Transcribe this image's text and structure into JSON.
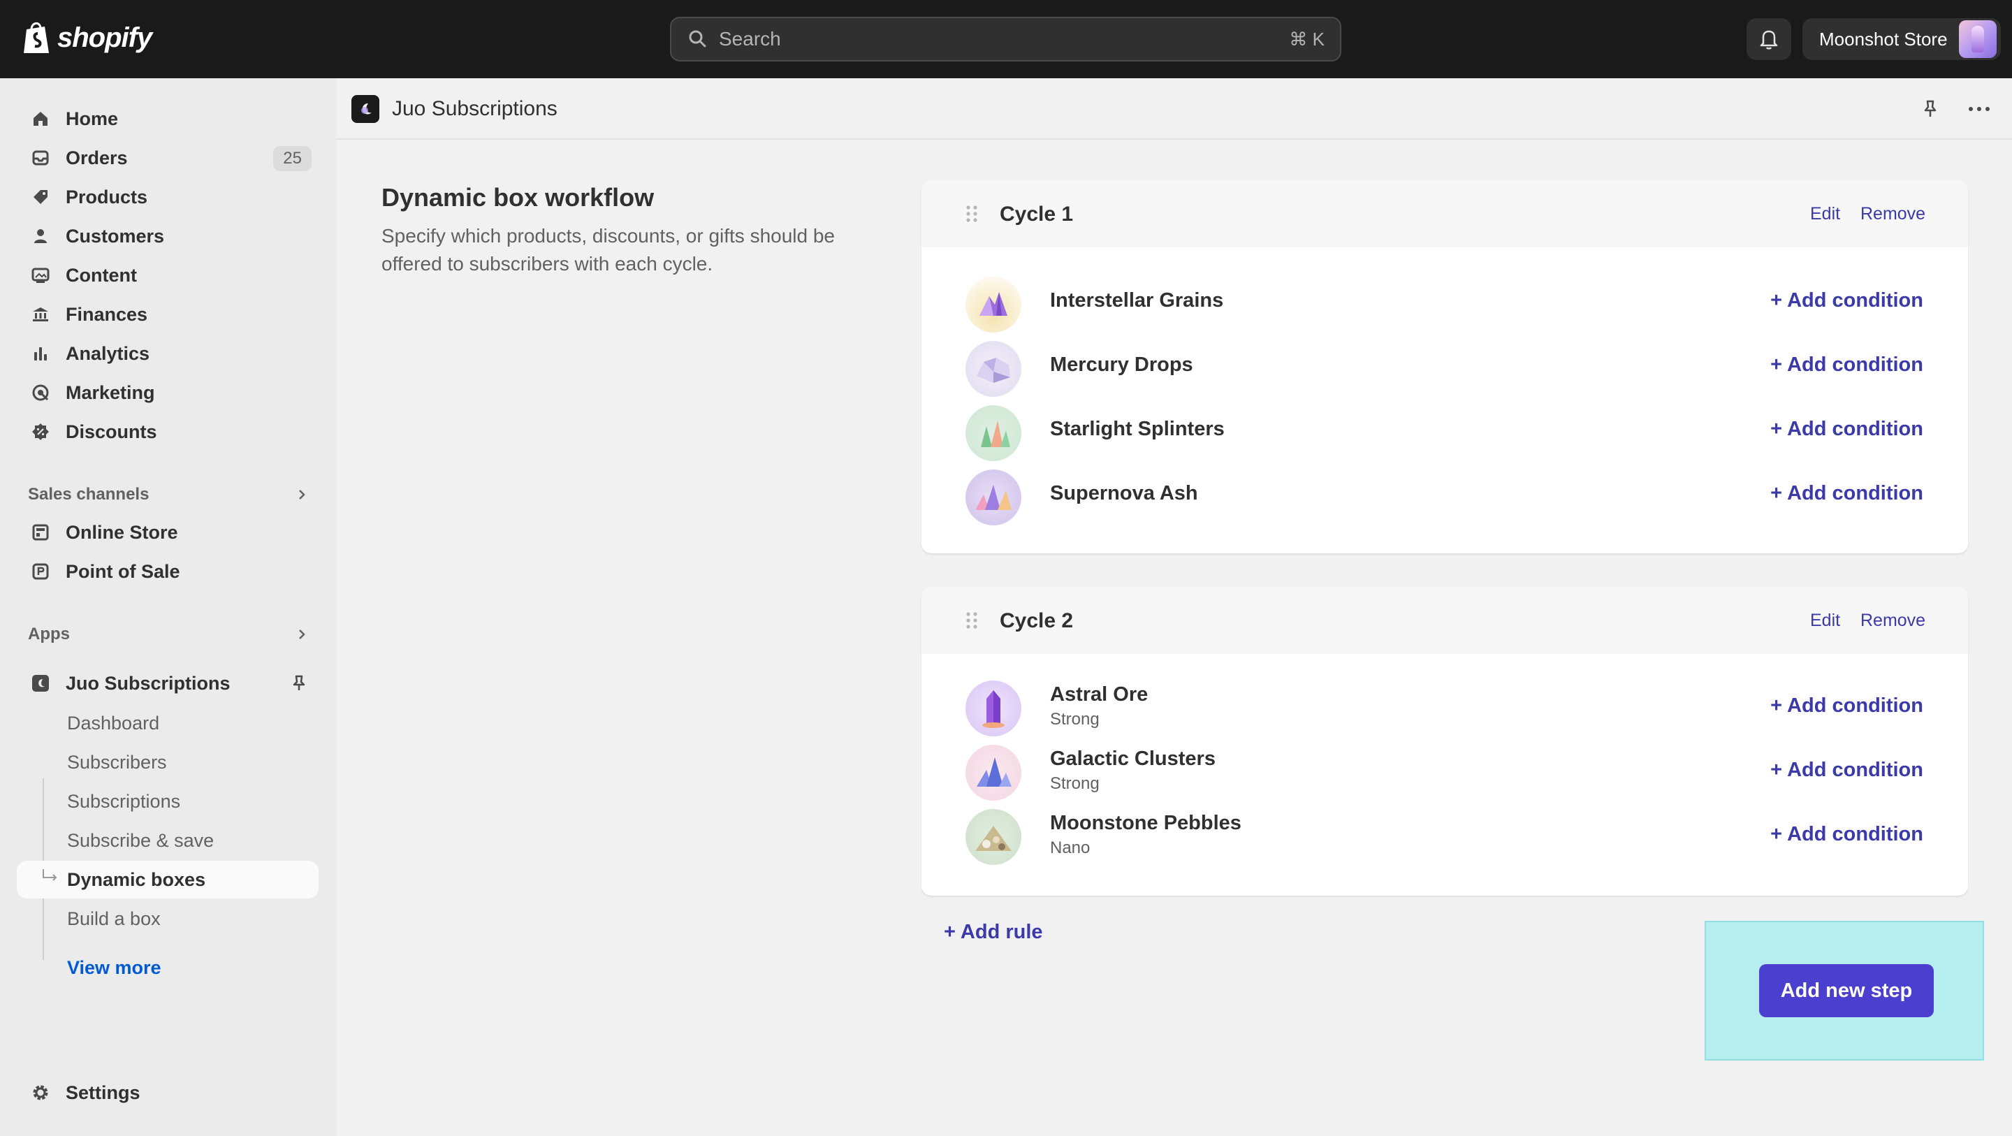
{
  "topbar": {
    "brand": "shopify",
    "search_placeholder": "Search",
    "search_shortcut": "⌘ K",
    "store_name": "Moonshot Store"
  },
  "sidebar": {
    "items": [
      {
        "label": "Home",
        "icon": "home-icon"
      },
      {
        "label": "Orders",
        "icon": "inbox-icon",
        "badge": "25"
      },
      {
        "label": "Products",
        "icon": "tag-icon"
      },
      {
        "label": "Customers",
        "icon": "person-icon"
      },
      {
        "label": "Content",
        "icon": "image-icon"
      },
      {
        "label": "Finances",
        "icon": "bank-icon"
      },
      {
        "label": "Analytics",
        "icon": "bar-chart-icon"
      },
      {
        "label": "Marketing",
        "icon": "target-icon"
      },
      {
        "label": "Discounts",
        "icon": "discount-icon"
      }
    ],
    "sales_channels_title": "Sales channels",
    "sales_channels": [
      {
        "label": "Online Store",
        "icon": "store-icon"
      },
      {
        "label": "Point of Sale",
        "icon": "pos-icon"
      }
    ],
    "apps_title": "Apps",
    "app": {
      "label": "Juo Subscriptions",
      "icon": "moon-icon"
    },
    "app_sub_items": [
      "Dashboard",
      "Subscribers",
      "Subscriptions",
      "Subscribe & save",
      "Dynamic boxes",
      "Build a box"
    ],
    "active_sub_item": "Dynamic boxes",
    "view_more": "View more",
    "settings": "Settings"
  },
  "app_header": {
    "title": "Juo Subscriptions"
  },
  "workflow": {
    "title": "Dynamic box workflow",
    "description": "Specify which products, discounts, or gifts should be offered to subscribers with each cycle."
  },
  "cycles": [
    {
      "title": "Cycle 1",
      "edit": "Edit",
      "remove": "Remove",
      "products": [
        {
          "name": "Interstellar Grains",
          "action": "+ Add condition"
        },
        {
          "name": "Mercury Drops",
          "action": "+ Add condition"
        },
        {
          "name": "Starlight Splinters",
          "action": "+ Add condition"
        },
        {
          "name": "Supernova Ash",
          "action": "+ Add condition"
        }
      ]
    },
    {
      "title": "Cycle 2",
      "edit": "Edit",
      "remove": "Remove",
      "products": [
        {
          "name": "Astral Ore",
          "sub": "Strong",
          "action": "+ Add condition"
        },
        {
          "name": "Galactic Clusters",
          "sub": "Strong",
          "action": "+ Add condition"
        },
        {
          "name": "Moonstone Pebbles",
          "sub": "Nano",
          "action": "+ Add condition"
        }
      ]
    }
  ],
  "add_rule": "+ Add rule",
  "add_step": "Add new step",
  "colors": {
    "topbar": "#1a1a1a",
    "accent": "#3b3aa8",
    "primary_button": "#4a3fcf",
    "highlight": "#b6eef0"
  }
}
